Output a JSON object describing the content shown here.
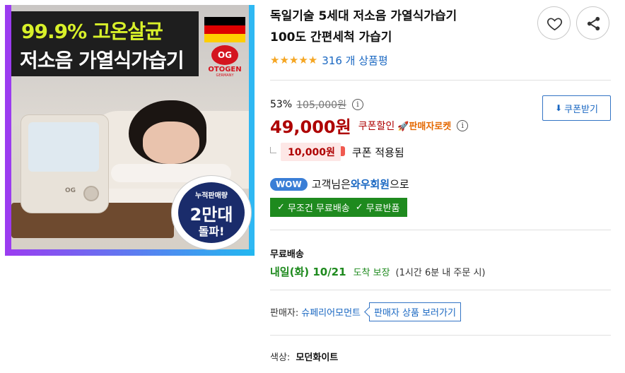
{
  "product_image": {
    "promo_line1": "99.9% 고온살균",
    "promo_line2": "저소음 가열식가습기",
    "brand_logo_text": "OTOGEN",
    "brand_logo_sub": "GERMANY",
    "logo_mark": "OG",
    "badge_top": "누적판매량",
    "badge_mid": "2만대",
    "badge_bot": "돌파!",
    "humidifier_logo": "OG"
  },
  "product": {
    "title_line1": "독일기술 5세대 저소음 가열식가습기",
    "title_line2": "100도 간편세척 가습기",
    "stars": "★★★★★",
    "review_count": "316 개 상품평",
    "rating_fraction": 1.0
  },
  "actions": {
    "wishlist_icon": "heart-icon",
    "share_icon": "share-icon"
  },
  "price": {
    "discount_rate": "53%",
    "original_price": "105,000원",
    "info_glyph": "i",
    "sale_price": "49,000원",
    "coupon_label": "쿠폰할인",
    "rocket_label": "🚀판매자로켓",
    "coupon_button": "쿠폰받기",
    "coupon_amount": "10,000원",
    "coupon_applied_text": "쿠폰 적용됨"
  },
  "wow": {
    "pill": "WOW",
    "text_before": "고객님은",
    "member_label": "와우회원",
    "text_after": "으로",
    "benefit1": "무조건 무료배송",
    "benefit2": "무료반품"
  },
  "shipping": {
    "heading": "무료배송",
    "date": "내일(화) 10/21",
    "guarantee": "도착 보장",
    "note": "(1시간 6분 내 주문 시)"
  },
  "seller": {
    "label": "판매자:",
    "name": "슈페리어모먼트",
    "link": "판매자 상품 보러가기"
  },
  "option": {
    "label": "색상:",
    "value": "모던화이트"
  },
  "colors": {
    "price_red": "#ae0000",
    "link_blue": "#1967c2",
    "ship_green": "#1e8a1e",
    "star_orange": "#f5a623"
  }
}
